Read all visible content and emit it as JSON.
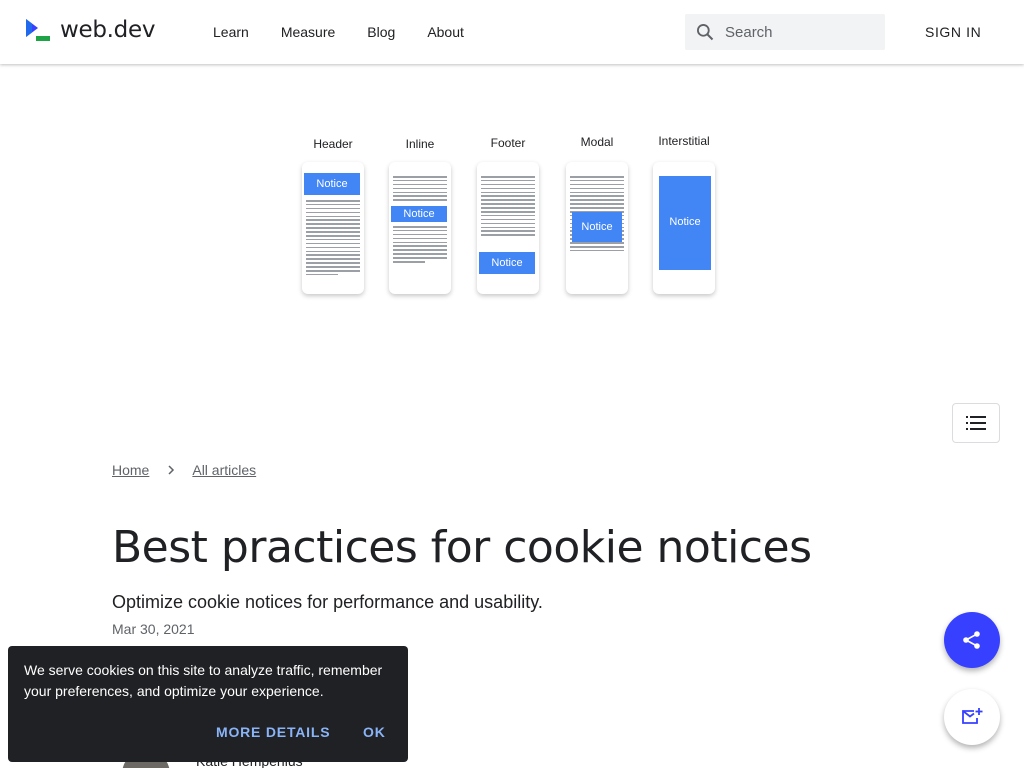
{
  "header": {
    "logo_text": "web.dev",
    "nav": [
      "Learn",
      "Measure",
      "Blog",
      "About"
    ],
    "search_placeholder": "Search",
    "signin_label": "SIGN IN"
  },
  "hero": {
    "labels": [
      "Header",
      "Inline",
      "Footer",
      "Modal",
      "Interstitial"
    ],
    "notice_label": "Notice"
  },
  "breadcrumb": {
    "home": "Home",
    "all_articles": "All articles"
  },
  "article": {
    "title": "Best practices for cookie notices",
    "subtitle": "Optimize cookie notices for performance and usability.",
    "date": "Mar 30, 2021",
    "author": "Katie Hempenius"
  },
  "cookie_notice": {
    "text": "We serve cookies on this site to analyze traffic, remember your preferences, and optimize your experience.",
    "more_details": "MORE DETAILS",
    "ok": "OK"
  },
  "colors": {
    "accent": "#3740ff",
    "notice_blue": "#4285f4",
    "cookie_bg": "#202124",
    "cookie_link": "#8ab4f8"
  }
}
